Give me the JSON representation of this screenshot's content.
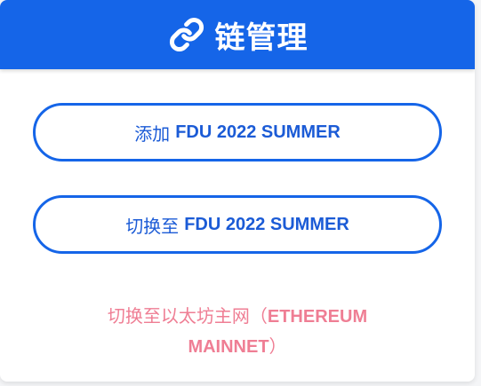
{
  "header": {
    "title": "链管理",
    "icon": "link-icon",
    "bg_color": "#1565e8"
  },
  "buttons": {
    "add": {
      "prefix": "添加",
      "chain": "FDU 2022 SUMMER"
    },
    "switch": {
      "prefix": "切换至",
      "chain": "FDU 2022 SUMMER"
    }
  },
  "mainnet": {
    "prefix": "切换至以太坊主网（",
    "name": "ETHEREUM MAINNET",
    "suffix": "）",
    "color": "#ef7e94"
  },
  "accent_color": "#1565e8"
}
